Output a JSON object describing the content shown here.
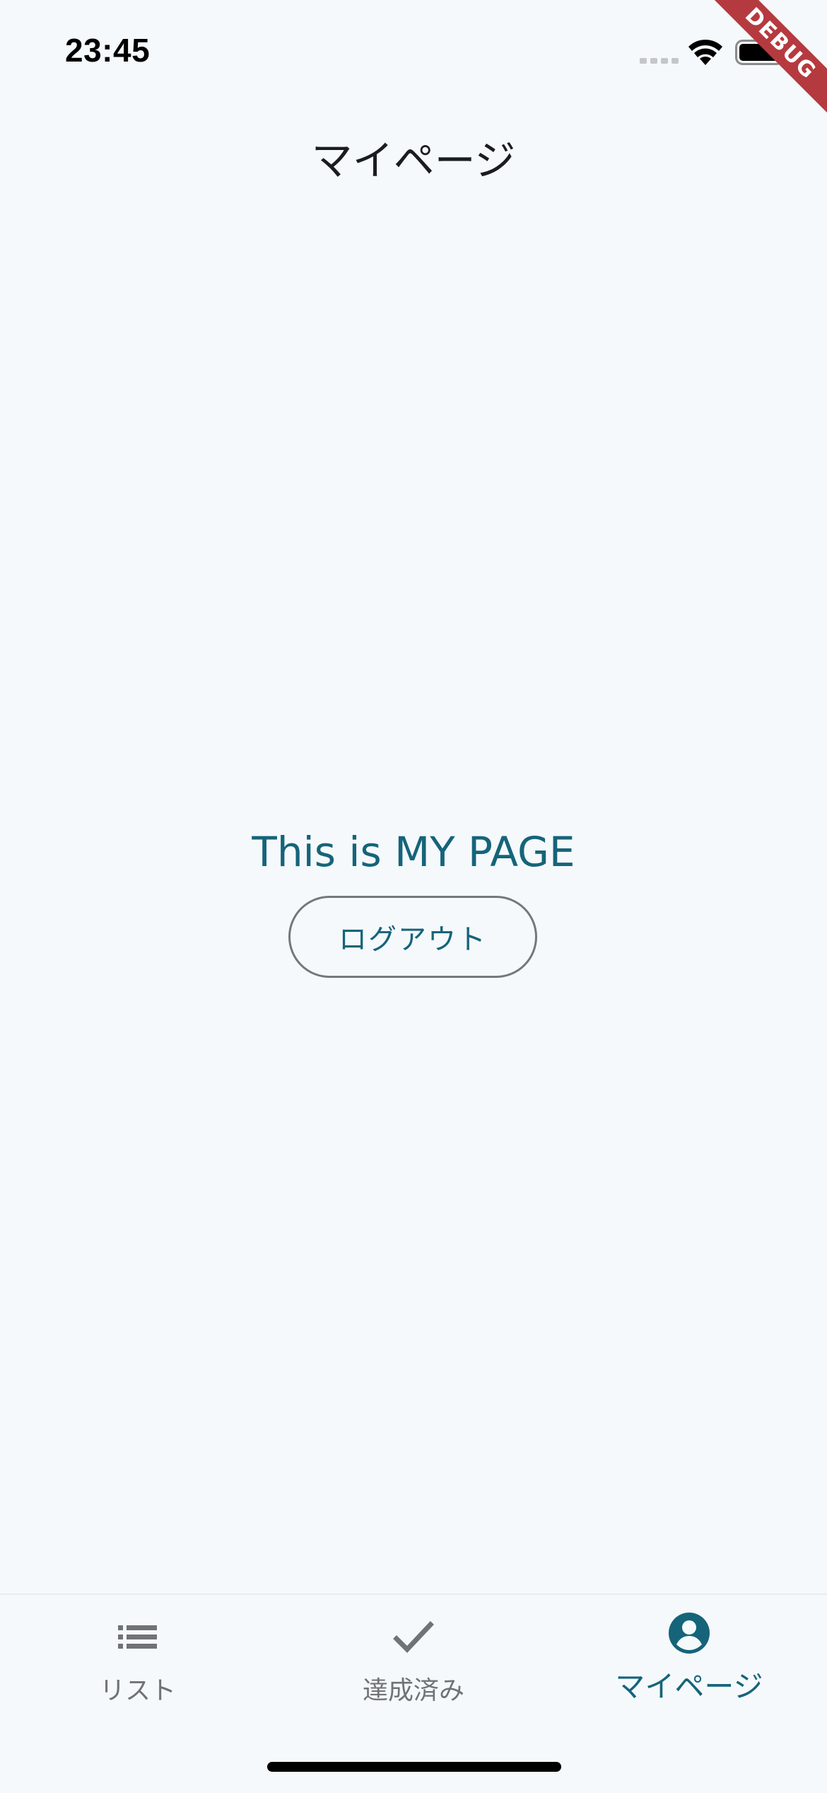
{
  "status_bar": {
    "time": "23:45",
    "icons": [
      "signal-icon",
      "wifi-icon",
      "battery-icon"
    ]
  },
  "debug_banner": "DEBUG",
  "app_bar": {
    "title": "マイページ"
  },
  "main": {
    "message": "This is MY PAGE",
    "logout_label": "ログアウト"
  },
  "bottom_nav": {
    "items": [
      {
        "label": "リスト",
        "icon": "list-icon",
        "selected": false
      },
      {
        "label": "達成済み",
        "icon": "check-icon",
        "selected": false
      },
      {
        "label": "マイページ",
        "icon": "account-circle-icon",
        "selected": true
      }
    ]
  },
  "colors": {
    "background": "#f5f9fc",
    "accent": "#15647a",
    "inactive": "#6f7377",
    "outline": "#72787e",
    "debug": "#b53a3f"
  }
}
